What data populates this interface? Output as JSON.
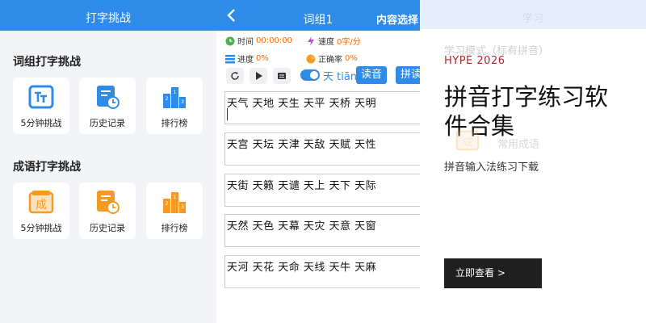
{
  "left": {
    "nav_title": "打字挑战",
    "section1": {
      "title": "词组打字挑战",
      "tiles": [
        {
          "label": "5分钟挑战",
          "icon": "tt-typing-icon"
        },
        {
          "label": "历史记录",
          "icon": "history-clock-icon"
        },
        {
          "label": "排行榜",
          "icon": "podium-icon"
        }
      ]
    },
    "section2": {
      "title": "成语打字挑战",
      "tiles": [
        {
          "label": "5分钟挑战",
          "icon": "cheng-idiom-icon"
        },
        {
          "label": "历史记录",
          "icon": "history-clock-icon"
        },
        {
          "label": "排行榜",
          "icon": "podium-icon"
        }
      ]
    }
  },
  "mid": {
    "nav_title": "词组1",
    "nav_right": "内容选择",
    "stats": {
      "time_label": "时间",
      "time_value": "00:00:00",
      "speed_label": "速度",
      "speed_value": "0字/分",
      "progress_label": "进度",
      "progress_value": "0%",
      "accuracy_label": "正确率",
      "accuracy_value": "0%"
    },
    "controls": {
      "pinyin_text": "天 tiān",
      "read_button": "读音",
      "pinyin_button": "拼读"
    },
    "word_rows": [
      "天气 天地 天生 天平 天桥 天明",
      "天宫 天坛 天津 天敌 天赋 天性",
      "天街 天籁 天谴 天上 天下 天际",
      "天然 天色 天幕 天灾 天意 天窗",
      "天河 天花 天命 天线 天牛 天麻"
    ]
  },
  "overlay": {
    "ghost_title": "学习",
    "mode_text": "学习模式（标有拼音）",
    "brand": "HYPE 2026",
    "headline": "拼音打字练习软件合集",
    "ghost_label": "常用成语",
    "subtitle": "拼音输入法练习下载",
    "cta": "立即查看 >"
  },
  "colors": {
    "primary_blue": "#2f8be8",
    "orange": "#f59a23",
    "brand_red": "#b3262d",
    "cta_dark": "#1f1f1f"
  }
}
